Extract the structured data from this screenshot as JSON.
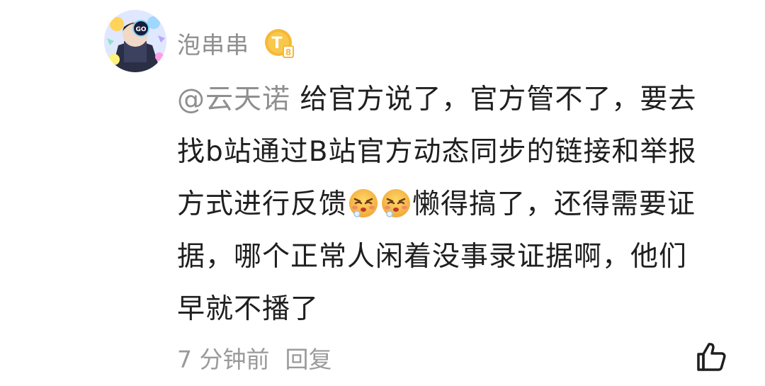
{
  "comment": {
    "username": "泡串串",
    "level_badge": "T",
    "level_sub": "8",
    "mention": "@云天诺",
    "lines": {
      "l1": " 给官方说了，官方管不了，要去",
      "l2": "找b站通过B站官方动态同步的链接和举报",
      "l3a": "方式进行反馈",
      "l3b": "懒得搞了，还得需要证",
      "l4": "据，哪个正常人闲着没事录证据啊，他们",
      "l5": "早就不播了"
    },
    "emoji_name": "sick-face-emoji",
    "avatar_text": "GO",
    "time": "7 分钟前",
    "reply_label": "回复",
    "like_icon": "thumbs-up-icon"
  }
}
